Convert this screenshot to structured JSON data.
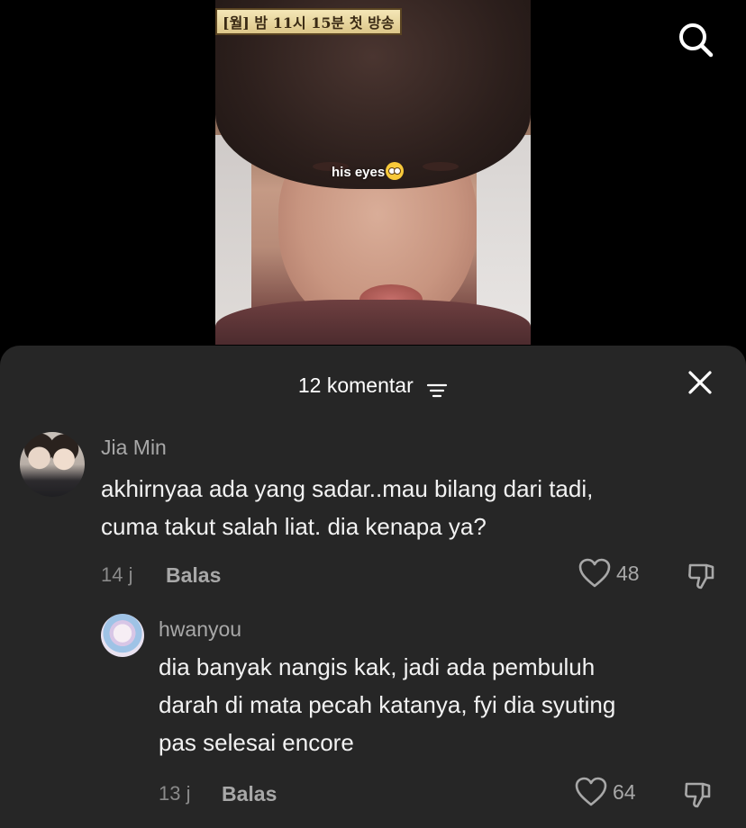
{
  "video": {
    "banner_text": "[월] 밤 11시 15분 첫 방송",
    "overlay_text": "his eyes"
  },
  "header_icons": {
    "search": "search-icon"
  },
  "comments_sheet": {
    "title": "12 komentar",
    "filter_icon": "filter-icon",
    "close_icon": "close-icon"
  },
  "comments": [
    {
      "username": "Jia Min",
      "text_line1": "akhirnyaa ada yang sadar..mau bilang dari tadi,",
      "text_line2": "cuma takut salah liat. dia kenapa ya?",
      "time": "14 j",
      "reply_label": "Balas",
      "likes": "48"
    },
    {
      "username": "hwanyou",
      "text_line1": "dia banyak nangis kak, jadi ada pembuluh",
      "text_line2": "darah di mata pecah katanya, fyi dia syuting",
      "text_line3": "pas selesai encore",
      "time": "13 j",
      "reply_label": "Balas",
      "likes": "64"
    }
  ],
  "colors": {
    "sheet_bg": "#262626",
    "background": "#000000",
    "text_primary": "#f2f2f2",
    "text_secondary": "#a8a8a8"
  }
}
